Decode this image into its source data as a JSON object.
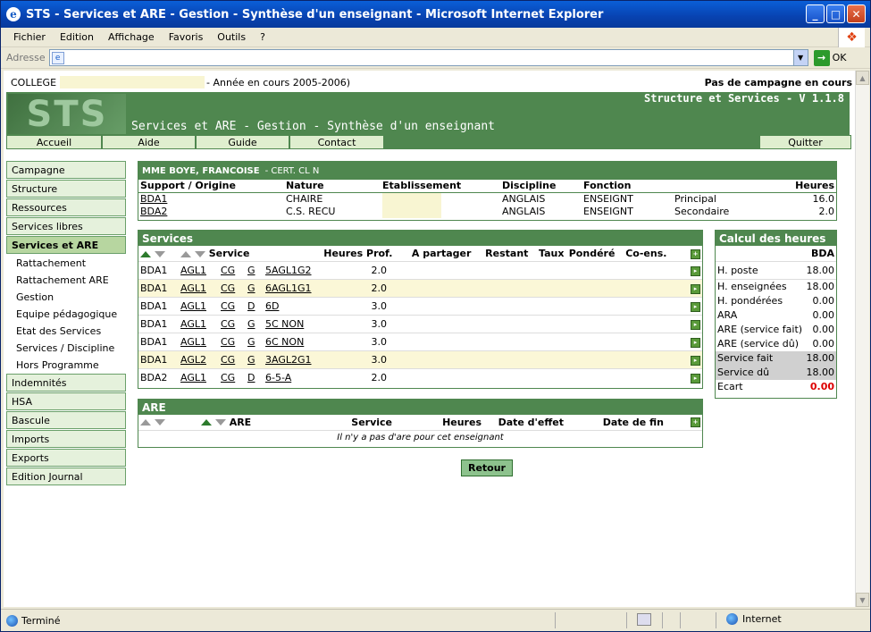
{
  "window": {
    "title": "STS - Services et ARE - Gestion - Synthèse d'un enseignant - Microsoft Internet Explorer"
  },
  "menu": [
    "Fichier",
    "Edition",
    "Affichage",
    "Favoris",
    "Outils",
    "?"
  ],
  "address": {
    "label": "Adresse",
    "go": "OK"
  },
  "status": {
    "left": "Terminé",
    "zone": "Internet"
  },
  "topline": {
    "college": "COLLEGE",
    "year": "- Année en cours 2005-2006)",
    "campaign": "Pas de campagne en cours"
  },
  "banner": {
    "version": "Structure et Services - V 1.1.8",
    "title": "Services et ARE - Gestion - Synthèse d'un enseignant"
  },
  "nav": [
    "Accueil",
    "Aide",
    "Guide",
    "Contact",
    "Quitter"
  ],
  "sidebar": {
    "items": [
      "Campagne",
      "Structure",
      "Ressources",
      "Services libres",
      "Services et ARE"
    ],
    "sub": [
      "Rattachement",
      "Rattachement ARE",
      "Gestion",
      "Equipe pédagogique",
      "Etat des Services",
      "Services / Discipline",
      "Hors Programme"
    ],
    "items2": [
      "Indemnités",
      "HSA",
      "Bascule",
      "Imports",
      "Exports",
      "Edition Journal"
    ]
  },
  "teacher": {
    "name": "MME BOYE, FRANCOISE",
    "grade": "- CERT. CL N",
    "headers": [
      "Support / Origine",
      "Nature",
      "Etablissement",
      "Discipline",
      "Fonction",
      "",
      "Heures"
    ],
    "rows": [
      [
        "BDA1",
        "CHAIRE",
        "",
        "ANGLAIS",
        "ENSEIGNT",
        "Principal",
        "16.0"
      ],
      [
        "BDA2",
        "C.S. RECU",
        "",
        "ANGLAIS",
        "ENSEIGNT",
        "Secondaire",
        "2.0"
      ]
    ]
  },
  "services": {
    "title": "Services",
    "headers": [
      "Service",
      "Heures Prof.",
      "A partager",
      "Restant",
      "Taux",
      "Pondéré",
      "Co-ens."
    ],
    "rows": [
      [
        "BDA1",
        "AGL1",
        "CG",
        "G",
        "5AGL1G2",
        "2.0"
      ],
      [
        "BDA1",
        "AGL1",
        "CG",
        "G",
        "6AGL1G1",
        "2.0"
      ],
      [
        "BDA1",
        "AGL1",
        "CG",
        "D",
        "6D",
        "3.0"
      ],
      [
        "BDA1",
        "AGL1",
        "CG",
        "G",
        "5C NON",
        "3.0"
      ],
      [
        "BDA1",
        "AGL1",
        "CG",
        "G",
        "6C NON",
        "3.0"
      ],
      [
        "BDA1",
        "AGL2",
        "CG",
        "G",
        "3AGL2G1",
        "3.0"
      ],
      [
        "BDA2",
        "AGL1",
        "CG",
        "D",
        "6-5-A",
        "2.0"
      ]
    ]
  },
  "are": {
    "title": "ARE",
    "headers": [
      "ARE",
      "Service",
      "Heures",
      "Date d'effet",
      "Date de fin"
    ],
    "empty": "Il n'y a pas d'are pour cet enseignant"
  },
  "retour": "Retour",
  "calc": {
    "title": "Calcul des heures",
    "col": "BDA",
    "rows": [
      [
        "H. poste",
        "18.00"
      ],
      [
        "H. enseignées",
        "18.00"
      ],
      [
        "H. pondérées",
        "0.00"
      ],
      [
        "ARA",
        "0.00"
      ],
      [
        "ARE (service fait)",
        "0.00"
      ],
      [
        "ARE (service dû)",
        "0.00"
      ],
      [
        "Service fait",
        "18.00"
      ],
      [
        "Service dû",
        "18.00"
      ],
      [
        "Ecart",
        "0.00"
      ]
    ]
  }
}
